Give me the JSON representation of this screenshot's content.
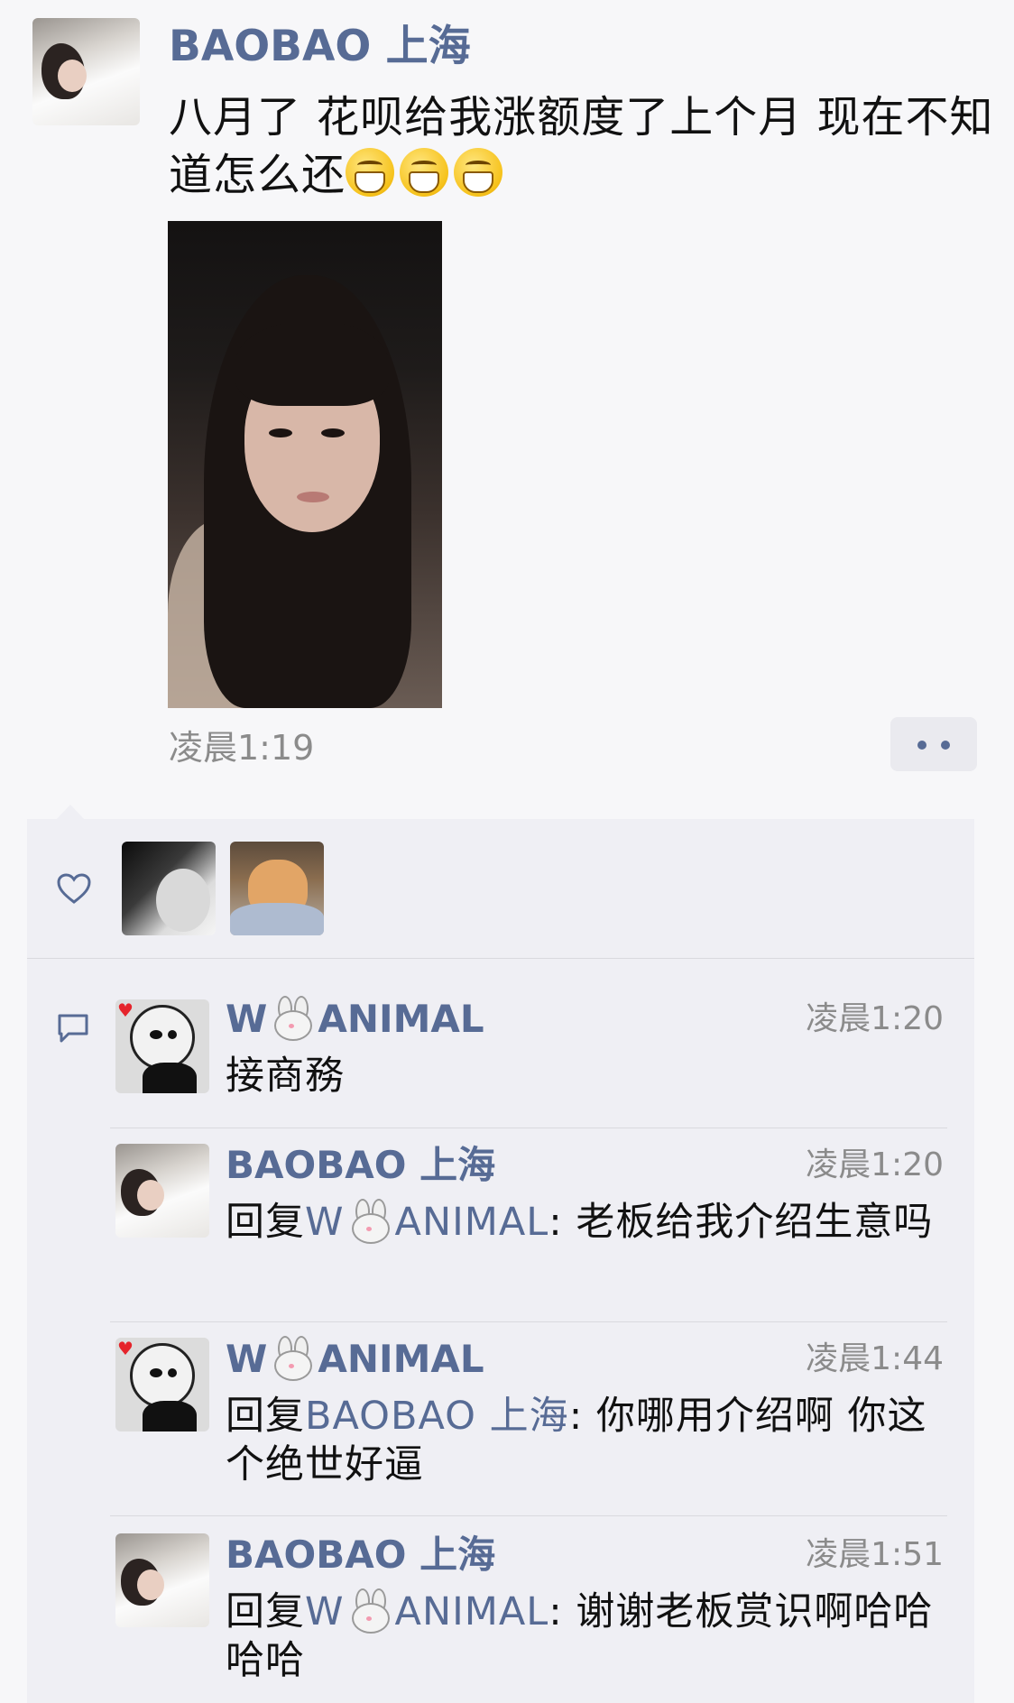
{
  "post": {
    "author": "BAOBAO 上海",
    "text": "八月了 花呗给我涨额度了上个月 现在不知道怎么还",
    "emoji_count": 3,
    "emoji": "grinning-face-emoji",
    "timestamp": "凌晨1:19"
  },
  "likes": {
    "icon": "heart-icon",
    "avatars": [
      "avatar-girl-bw",
      "avatar-cat"
    ]
  },
  "comments": [
    {
      "author_prefix": "W",
      "author_suffix": "ANIMAL",
      "has_bunny": true,
      "time": "凌晨1:20",
      "reply_prefix": "",
      "reply_to_prefix": "",
      "reply_to_suffix": "",
      "text": "接商務",
      "avatar": "monkey"
    },
    {
      "author": "BAOBAO 上海",
      "time": "凌晨1:20",
      "reply_prefix": "回复",
      "reply_to_prefix": "W",
      "reply_to_suffix": "ANIMAL",
      "text": ": 老板给我介绍生意吗",
      "avatar": "girl"
    },
    {
      "author_prefix": "W",
      "author_suffix": "ANIMAL",
      "has_bunny": true,
      "time": "凌晨1:44",
      "reply_prefix": "回复",
      "reply_to": "BAOBAO 上海",
      "text": ": 你哪用介绍啊 你这个绝世好逼",
      "avatar": "monkey"
    },
    {
      "author": "BAOBAO 上海",
      "time": "凌晨1:51",
      "reply_prefix": "回复",
      "reply_to_prefix": "W",
      "reply_to_suffix": "ANIMAL",
      "text": ": 谢谢老板赏识啊哈哈哈哈",
      "avatar": "girl"
    }
  ],
  "colors": {
    "name": "#576b95",
    "panel": "#efeff4",
    "background": "#f7f7f9",
    "timestamp": "#8b8b8b"
  }
}
